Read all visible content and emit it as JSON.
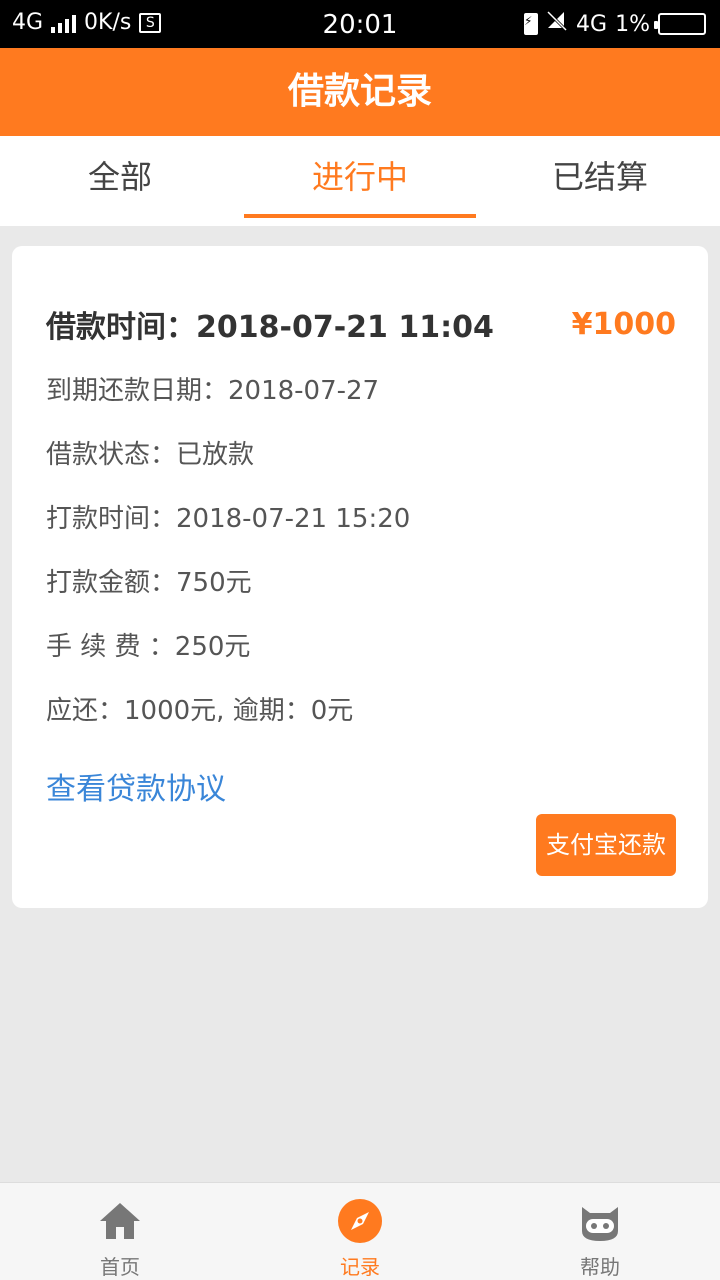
{
  "statusbar": {
    "network_left": "4G",
    "speed": "0K/s",
    "sim_symbol": "S",
    "time": "20:01",
    "network_right": "4G",
    "battery": "1%"
  },
  "header": {
    "title": "借款记录"
  },
  "tabs": [
    {
      "label": "全部"
    },
    {
      "label": "进行中"
    },
    {
      "label": "已结算"
    }
  ],
  "record": {
    "borrow_time": "借款时间：2018-07-21 11:04",
    "amount": "¥1000",
    "due_date": "到期还款日期：2018-07-27",
    "status": "借款状态：已放款",
    "pay_time": "打款时间：2018-07-21 15:20",
    "pay_amount": "打款金额：750元",
    "fee": "手 续 费 ：250元",
    "should_repay": "应还：1000元, 逾期：0元",
    "agreement_link": "查看贷款协议",
    "pay_button": "支付宝还款"
  },
  "bottomnav": {
    "items": [
      {
        "label": "首页",
        "icon": "home-icon"
      },
      {
        "label": "记录",
        "icon": "compass-icon"
      },
      {
        "label": "帮助",
        "icon": "cat-icon"
      }
    ]
  },
  "colors": {
    "accent": "#ff7a1f",
    "link": "#3a86d8"
  }
}
